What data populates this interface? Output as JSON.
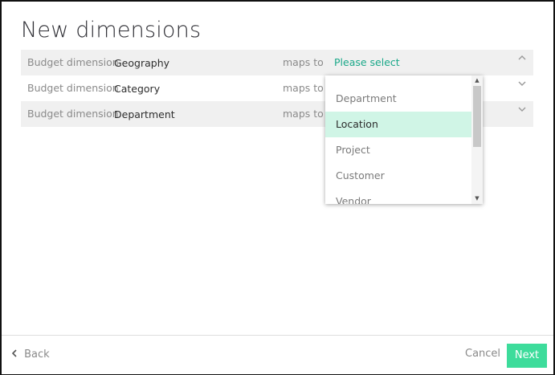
{
  "page": {
    "title": "New dimensions"
  },
  "rows": [
    {
      "label": "Budget dimension",
      "value": "Geography",
      "maps_to": "maps to",
      "select": "Please select",
      "chevron": "up"
    },
    {
      "label": "Budget dimension",
      "value": "Category",
      "maps_to": "maps to",
      "select": "",
      "chevron": "down"
    },
    {
      "label": "Budget dimension",
      "value": "Department",
      "maps_to": "maps to",
      "select": "",
      "chevron": "down"
    }
  ],
  "dropdown": {
    "options": [
      "Department",
      "Location",
      "Project",
      "Customer",
      "Vendor"
    ],
    "highlighted": "Location"
  },
  "footer": {
    "back": "Back",
    "cancel": "Cancel",
    "next": "Next"
  },
  "colors": {
    "accent": "#1aa889",
    "next_button": "#3ddc9b",
    "highlight": "#d0f5e6"
  }
}
